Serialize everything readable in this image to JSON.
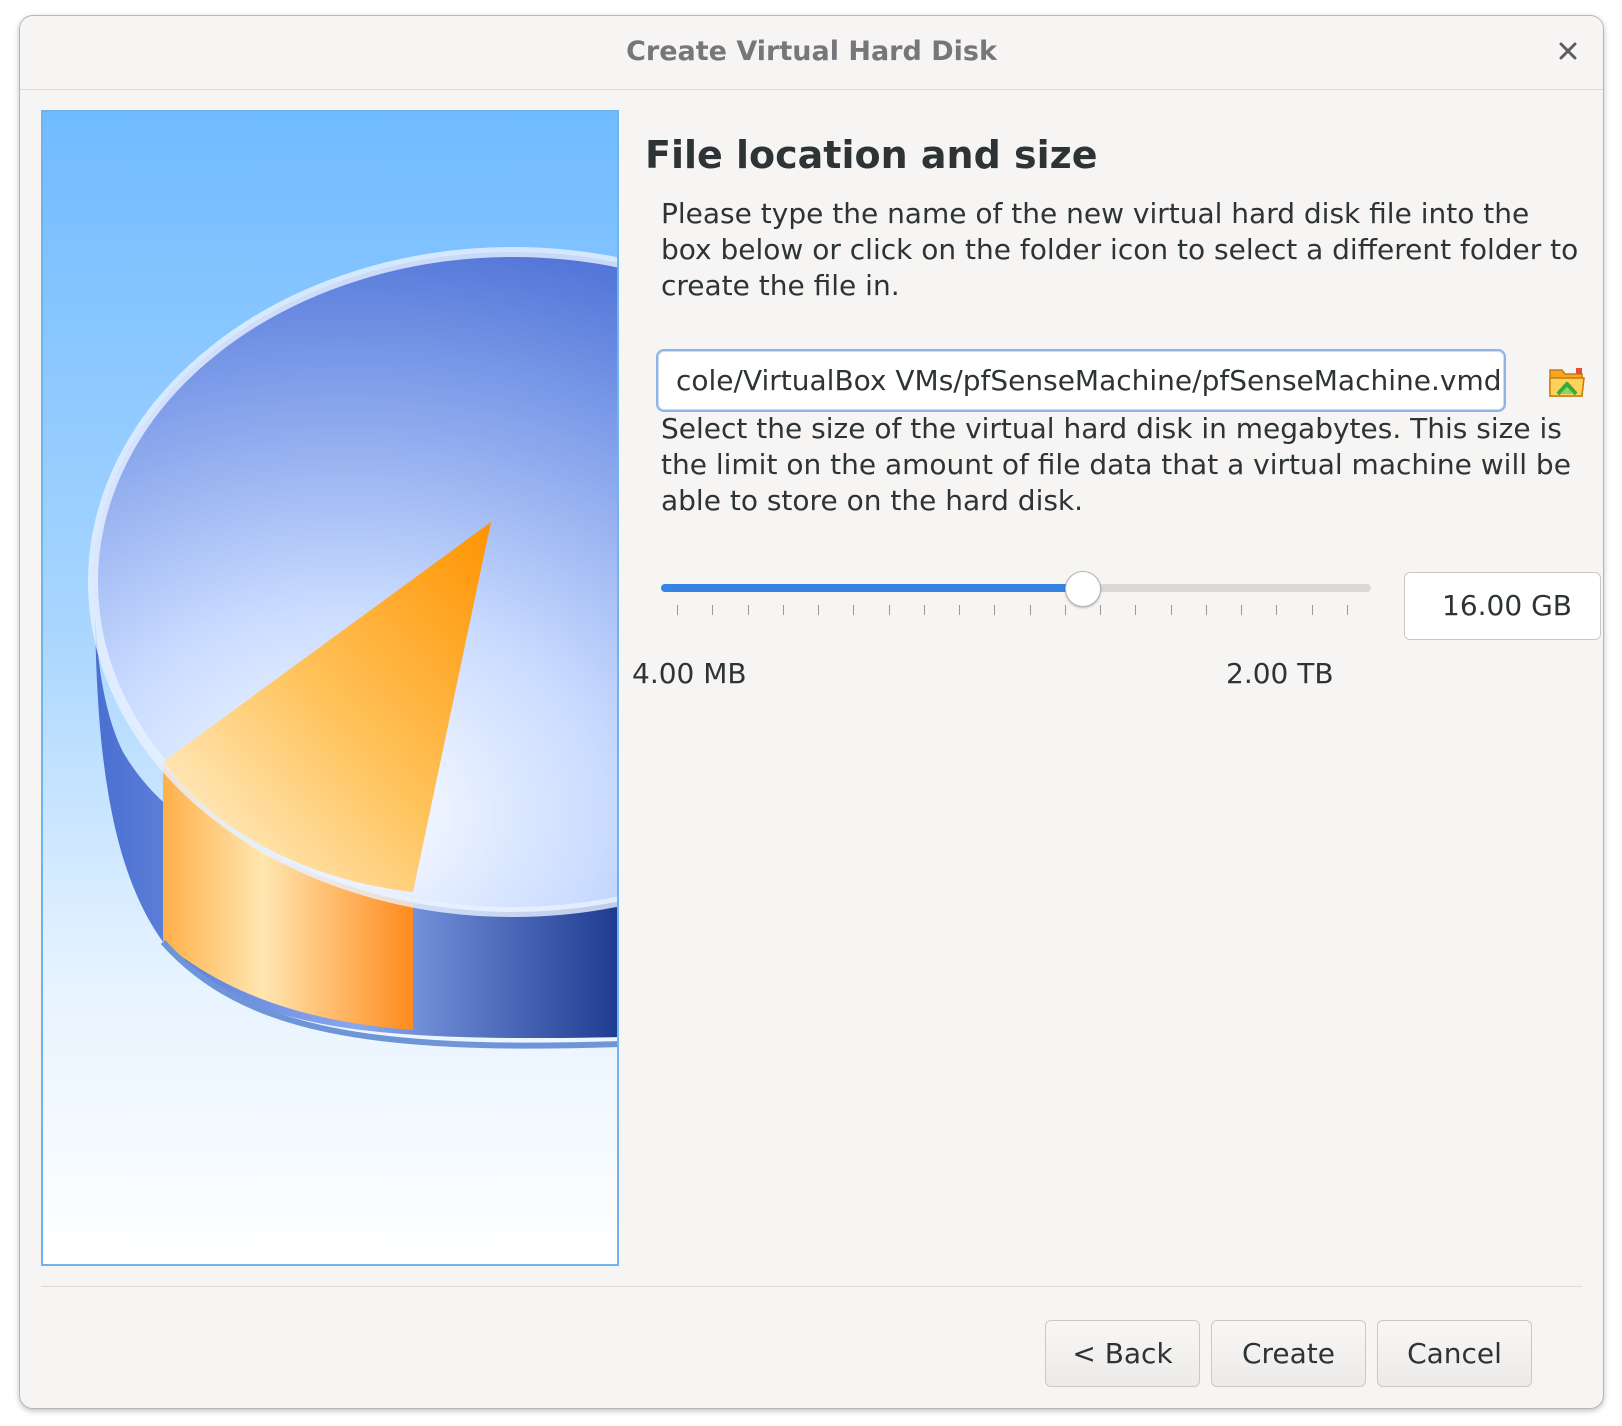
{
  "window": {
    "title": "Create Virtual Hard Disk"
  },
  "page": {
    "heading": "File location and size",
    "location_description": "Please type the name of the new virtual hard disk file into the box below or click on the folder icon to select a different folder to create the file in.",
    "file_path": "cole/VirtualBox VMs/pfSenseMachine/pfSenseMachine.vmdk",
    "size_description": "Select the size of the virtual hard disk in megabytes. This size is the limit on the amount of file data that a virtual machine will be able to store on the hard disk.",
    "size_value": "16.00 GB",
    "slider_fraction": 0.595,
    "range_min_label": "4.00 MB",
    "range_max_label": "2.00 TB"
  },
  "buttons": {
    "back": "< Back",
    "create": "Create",
    "cancel": "Cancel"
  },
  "icons": {
    "close": "close-icon",
    "folder": "folder-icon"
  },
  "colors": {
    "accent": "#3584e4",
    "input_focus": "#8fb3e4"
  }
}
